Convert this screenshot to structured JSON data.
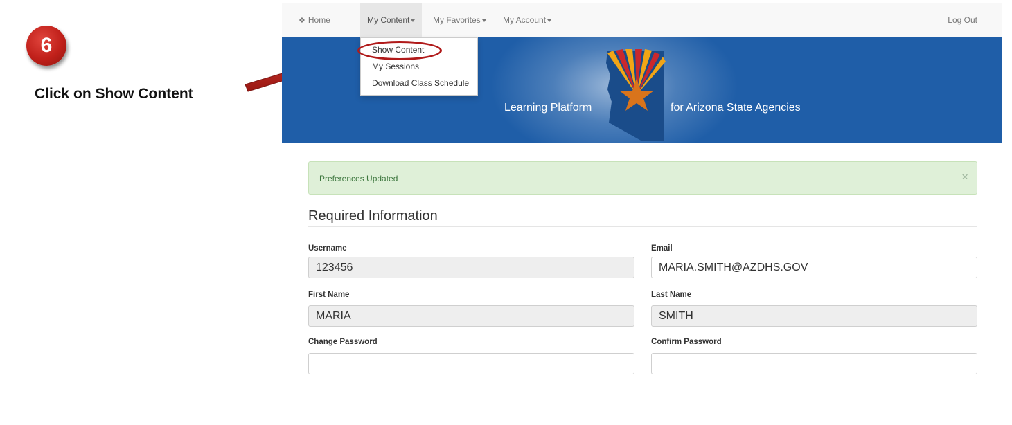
{
  "callout": {
    "step_number": "6",
    "instruction": "Click on Show Content",
    "badge_color": "#c0201a",
    "arrow_color": "#c0201a"
  },
  "navbar": {
    "home_icon": "home-icon",
    "home": "Home",
    "my_content": "My Content",
    "my_favorites": "My Favorites",
    "my_account": "My Account",
    "logout": "Log Out"
  },
  "dropdown": {
    "items": [
      "Show Content",
      "My Sessions",
      "Download Class Schedule"
    ]
  },
  "banner": {
    "text_left": "Learning Platform",
    "text_right": "for Arizona State Agencies",
    "color": "#1f5ea8"
  },
  "alert": {
    "message": "Preferences Updated",
    "close_icon": "×"
  },
  "form": {
    "section_title": "Required Information",
    "username_label": "Username",
    "username_value": "123456",
    "email_label": "Email",
    "email_value": "MARIA.SMITH@AZDHS.GOV",
    "first_name_label": "First Name",
    "first_name_value": "MARIA",
    "last_name_label": "Last Name",
    "last_name_value": "SMITH",
    "change_password_label": "Change Password",
    "confirm_password_label": "Confirm Password"
  }
}
